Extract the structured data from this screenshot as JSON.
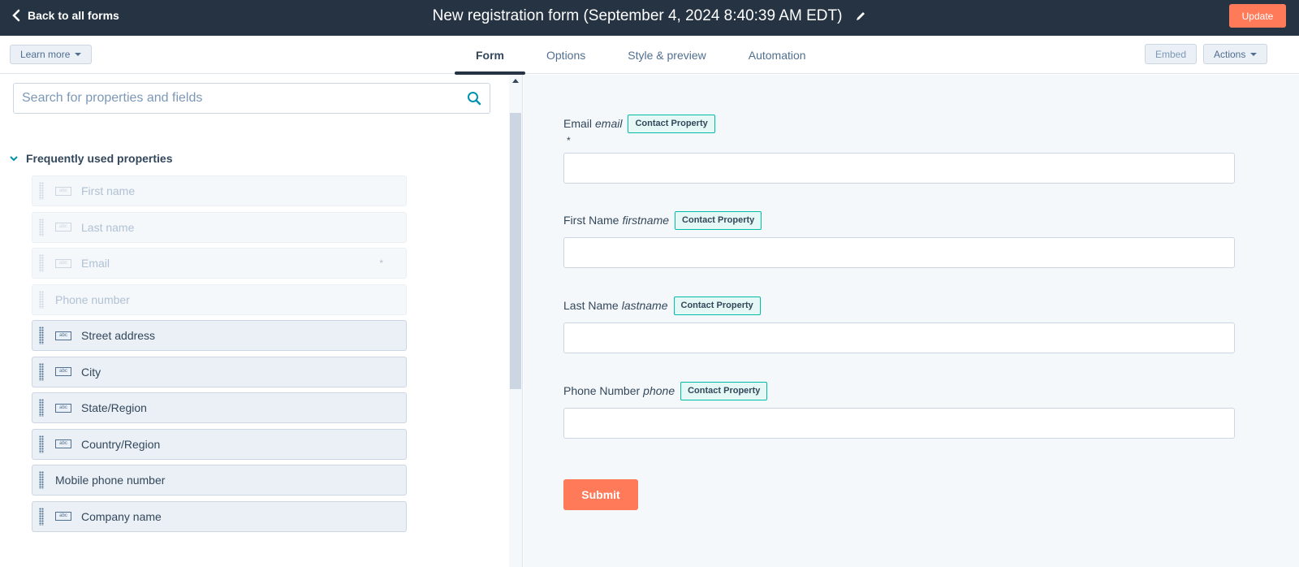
{
  "topbar": {
    "back_label": "Back to all forms",
    "title": "New registration form (September 4, 2024 8:40:39 AM EDT)",
    "update_label": "Update"
  },
  "subbar": {
    "learn_more": "Learn more",
    "tabs": [
      {
        "label": "Form",
        "active": true
      },
      {
        "label": "Options",
        "active": false
      },
      {
        "label": "Style & preview",
        "active": false
      },
      {
        "label": "Automation",
        "active": false
      }
    ],
    "embed": "Embed",
    "actions": "Actions"
  },
  "left": {
    "search_placeholder": "Search for properties and fields",
    "section_title": "Frequently used properties",
    "abc_text": "abc",
    "required_mark": "*",
    "fields": [
      {
        "label": "First name",
        "disabled": true,
        "icon": true
      },
      {
        "label": "Last name",
        "disabled": true,
        "icon": true
      },
      {
        "label": "Email",
        "disabled": true,
        "icon": true,
        "required": true
      },
      {
        "label": "Phone number",
        "disabled": true,
        "icon": false
      },
      {
        "label": "Street address",
        "disabled": false,
        "icon": true
      },
      {
        "label": "City",
        "disabled": false,
        "icon": true
      },
      {
        "label": "State/Region",
        "disabled": false,
        "icon": true
      },
      {
        "label": "Country/Region",
        "disabled": false,
        "icon": true
      },
      {
        "label": "Mobile phone number",
        "disabled": false,
        "icon": false
      },
      {
        "label": "Company name",
        "disabled": false,
        "icon": true
      }
    ]
  },
  "preview": {
    "badge": "Contact Property",
    "star": "*",
    "fields": [
      {
        "label": "Email",
        "internal": "email"
      },
      {
        "label": "First Name",
        "internal": "firstname"
      },
      {
        "label": "Last Name",
        "internal": "lastname"
      },
      {
        "label": "Phone Number",
        "internal": "phone"
      }
    ],
    "submit": "Submit"
  },
  "colors": {
    "topbar": "#253342",
    "accent": "#ff7a59",
    "badge_border": "#00bda5"
  }
}
